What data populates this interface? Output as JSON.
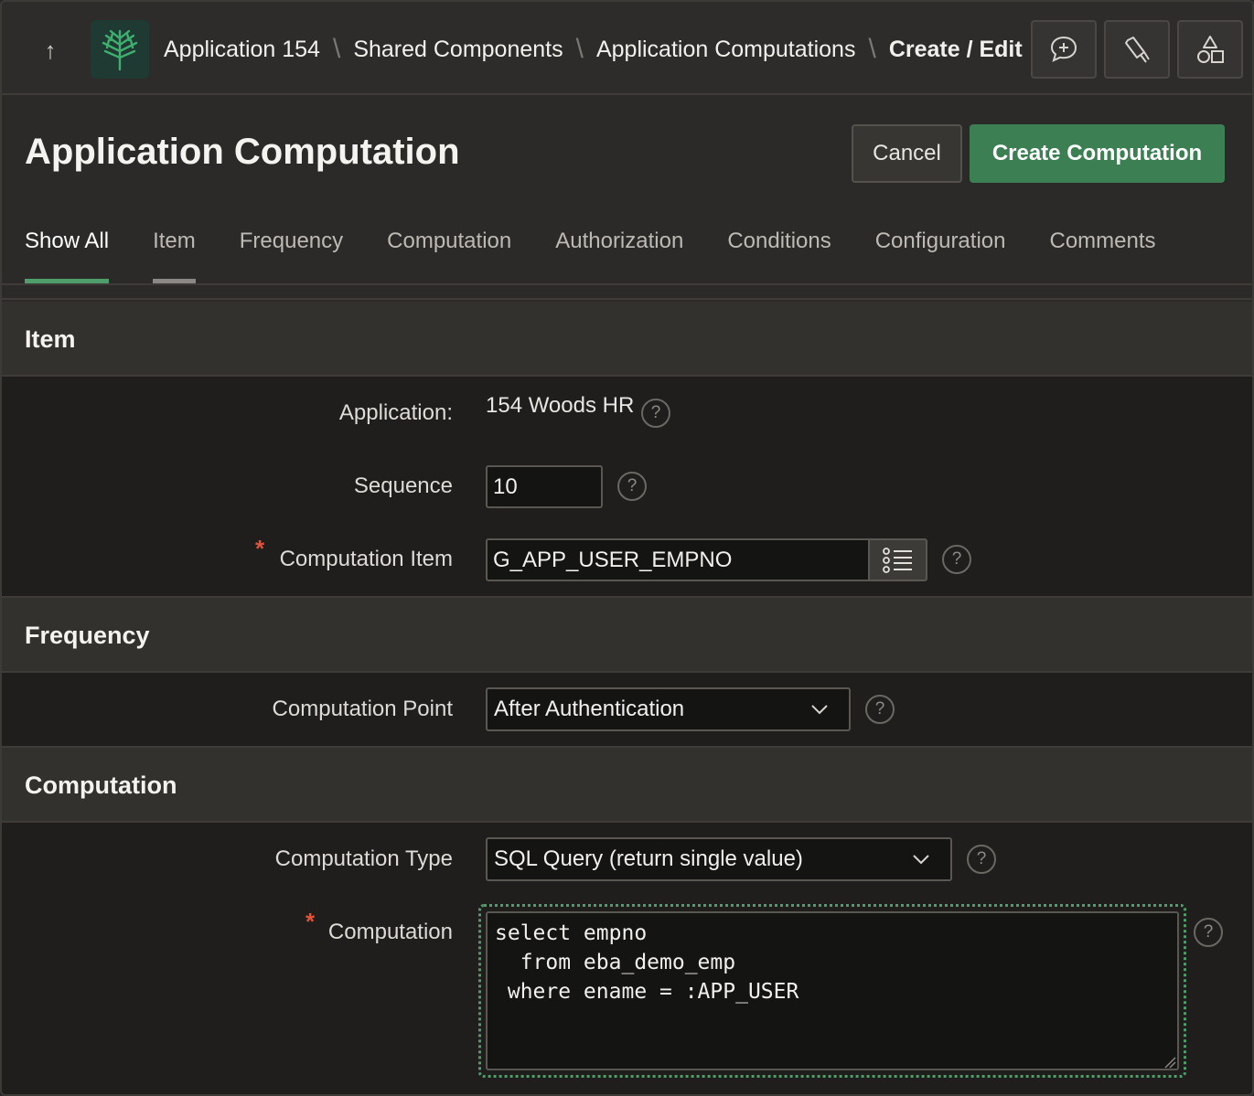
{
  "header": {
    "breadcrumb": [
      "Application 154",
      "Shared Components",
      "Application Computations",
      "Create / Edit"
    ],
    "icons": [
      "arrow-up-icon",
      "app-logo-tree",
      "comment-add-icon",
      "flashlight-icon",
      "shapes-icon"
    ]
  },
  "page": {
    "title": "Application Computation",
    "cancel_label": "Cancel",
    "create_label": "Create Computation"
  },
  "tabs": [
    "Show All",
    "Item",
    "Frequency",
    "Computation",
    "Authorization",
    "Conditions",
    "Configuration",
    "Comments"
  ],
  "sections": {
    "item": {
      "heading": "Item",
      "application_label": "Application:",
      "application_value": "154 Woods HR",
      "sequence_label": "Sequence",
      "sequence_value": "10",
      "computation_item_label": "Computation Item",
      "computation_item_value": "G_APP_USER_EMPNO",
      "required_marker": "*"
    },
    "frequency": {
      "heading": "Frequency",
      "computation_point_label": "Computation Point",
      "computation_point_value": "After Authentication"
    },
    "computation": {
      "heading": "Computation",
      "type_label": "Computation Type",
      "type_value": "SQL Query (return single value)",
      "computation_label": "Computation",
      "computation_value": "select empno\n  from eba_demo_emp\n where ename = :APP_USER",
      "required_marker": "*"
    }
  },
  "help_glyph": "?",
  "colors": {
    "accent": "#3b7f52",
    "required": "#e0533a",
    "background": "#2c2a28"
  }
}
